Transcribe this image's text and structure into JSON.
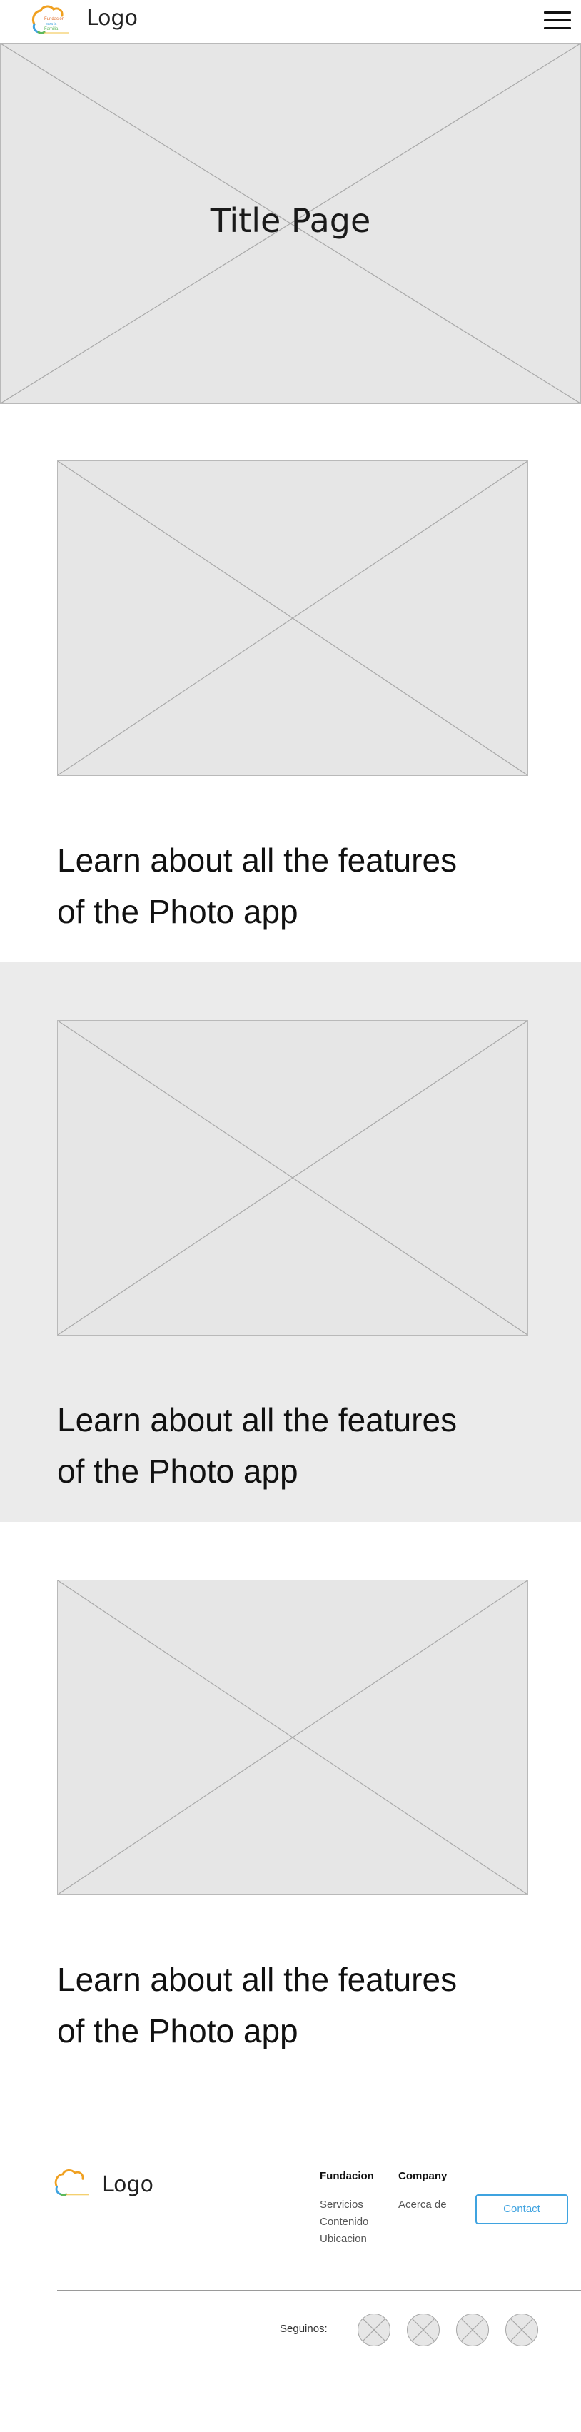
{
  "header": {
    "logo_text": "Logo",
    "logo_small": [
      "Fundación",
      "para la",
      "Familia"
    ],
    "menu_icon": "hamburger-icon"
  },
  "hero": {
    "title": "Title Page"
  },
  "features": [
    {
      "line1": "Learn about all the features",
      "line2": "of the Photo app"
    },
    {
      "line1": "Learn about all the features",
      "line2": "of the Photo app"
    },
    {
      "line1": "Learn about all the features",
      "line2": "of the Photo app"
    }
  ],
  "footer": {
    "logo_text": "Logo",
    "col1": {
      "heading": "Fundacion",
      "links": [
        "Servicios",
        "Contenido",
        "Ubicacion"
      ]
    },
    "col2": {
      "heading": "Company",
      "links": [
        "Acerca de"
      ]
    },
    "contact_label": "Contact",
    "follow_label": "Seguinos:",
    "social_icons": [
      "social-icon-1",
      "social-icon-2",
      "social-icon-3",
      "social-icon-4"
    ]
  },
  "colors": {
    "accent": "#3fa3e0",
    "placeholder": "#e6e6e6",
    "alt_section": "#ebebeb"
  }
}
